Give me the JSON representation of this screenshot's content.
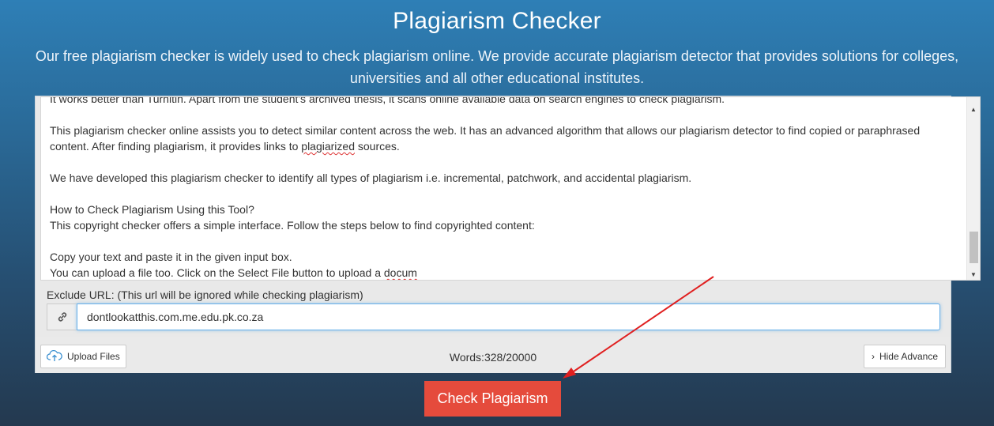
{
  "header": {
    "title": "Plagiarism Checker",
    "subtitle": "Our free plagiarism checker is widely used to check plagiarism online. We provide accurate plagiarism detector that provides solutions for colleges, universities and all other educational institutes."
  },
  "editor": {
    "line_partial": "It works better than Turnitin. Apart from the student's archived thesis, it scans online available data on search engines to check plagiarism.",
    "para1_a": "This plagiarism checker online assists you to detect similar content across the web. It has an advanced algorithm that allows our plagiarism detector to find copied or paraphrased content. After finding plagiarism, it provides links to ",
    "para1_b": "plagiarized",
    "para1_c": " sources.",
    "para2": "We have developed this plagiarism checker to identify all types of plagiarism i.e. incremental, patchwork, and accidental plagiarism.",
    "para3_line1": "How to Check Plagiarism Using this Tool?",
    "para3_line2": "This copyright checker offers a simple interface. Follow the steps below to find copyrighted content:",
    "para4_line1": "Copy your text and paste it in the given input box.",
    "para4_line2_a": "You can upload a file too. Click on the Select File button to upload a ",
    "para4_line2_b": "docum"
  },
  "exclude": {
    "label": "Exclude URL: (This url will be ignored while checking plagiarism)",
    "value": "dontlookatthis.com.me.edu.pk.co.za",
    "icon": "link-icon"
  },
  "toolbar": {
    "upload_label": "Upload Files",
    "words": "Words:328/20000",
    "hide_label": "Hide Advance"
  },
  "actions": {
    "check_label": "Check Plagiarism"
  },
  "colors": {
    "check_button": "#e54b3c",
    "annotation_arrow": "#e02020"
  }
}
